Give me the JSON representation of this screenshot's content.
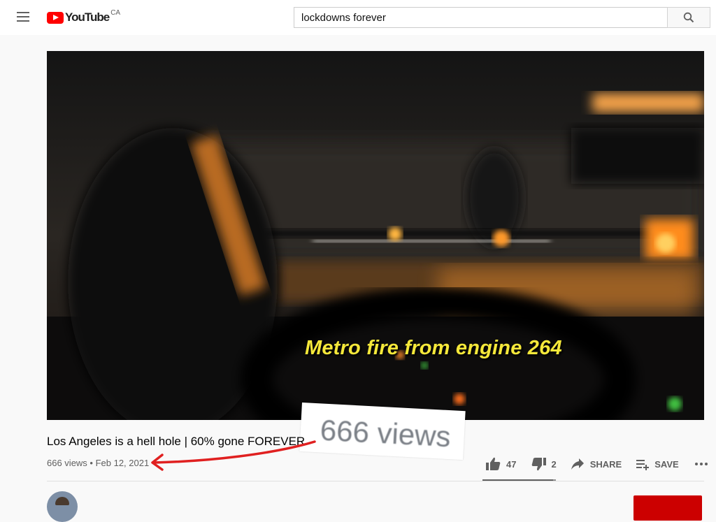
{
  "header": {
    "logo_text": "YouTube",
    "region": "CA",
    "search_value": "lockdowns forever"
  },
  "video": {
    "caption": "Metro fire from engine 264"
  },
  "callout": {
    "text": "666 views"
  },
  "details": {
    "title": "Los Angeles is a hell hole | 60% gone FOREVER",
    "meta": "666 views • Feb 12, 2021"
  },
  "actions": {
    "likes": "47",
    "dislikes": "2",
    "share_label": "SHARE",
    "save_label": "SAVE",
    "like_ratio": 0.96
  },
  "colors": {
    "brand": "#ff0000",
    "annotation_arrow": "#e02020",
    "caption": "#f5e83a"
  },
  "icons": [
    "menu-icon",
    "youtube-logo-icon",
    "search-icon",
    "thumbs-up-icon",
    "thumbs-down-icon",
    "share-icon",
    "save-playlist-icon",
    "more-icon"
  ]
}
